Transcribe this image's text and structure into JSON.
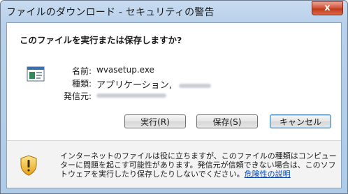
{
  "window": {
    "title": "ファイルのダウンロード - セキュリティの警告",
    "close_glyph": "x"
  },
  "dialog": {
    "question": "このファイルを実行または保存しますか?",
    "file_info": {
      "name_label": "名前:",
      "name_value": "wvasetup.exe",
      "type_label": "種類:",
      "type_value": "アプリケーション,",
      "source_label": "発信元:"
    },
    "buttons": {
      "run": "実行(R)",
      "save": "保存(S)",
      "cancel": "キャンセル"
    }
  },
  "warning": {
    "text": "インターネットのファイルは役に立ちますが、このファイルの種類はコンピューターに問題を起こす可能性があります。発信元が信頼できない場合は、このソフトウェアを実行したり保存したりしないでください。",
    "link": "危険性の説明"
  },
  "icons": {
    "file": "application-file-icon",
    "warning": "security-shield-icon",
    "close": "close-icon"
  }
}
